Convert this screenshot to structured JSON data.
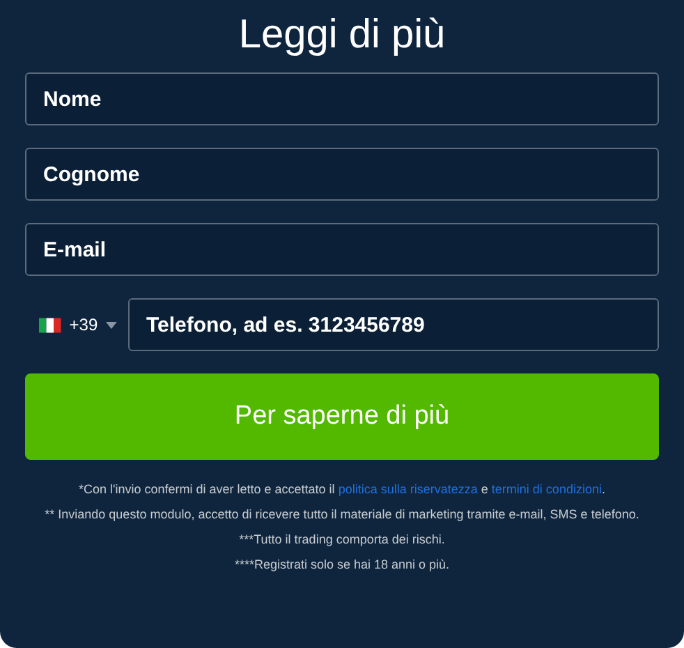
{
  "title": "Leggi di più",
  "fields": [
    {
      "placeholder": "Nome"
    },
    {
      "placeholder": "Cognome"
    },
    {
      "placeholder": "E-mail"
    }
  ],
  "phone": {
    "country_code": "+39",
    "placeholder": "Telefono, ad es. 3123456789"
  },
  "submit": "Per saperne di più",
  "consent": {
    "before": "*Con l'invio confermi di aver letto e accettato il",
    "links": [
      "politica sulla riservatezza",
      "termini di condizioni"
    ],
    "middle": "e",
    "after": "."
  },
  "notes": [
    "** Inviando questo modulo, accetto di ricevere tutto il materiale di marketing tramite e-mail, SMS e telefono.",
    "***Tutto il trading comporta dei rischi.",
    "****Registrati solo se hai 18 anni o più."
  ]
}
